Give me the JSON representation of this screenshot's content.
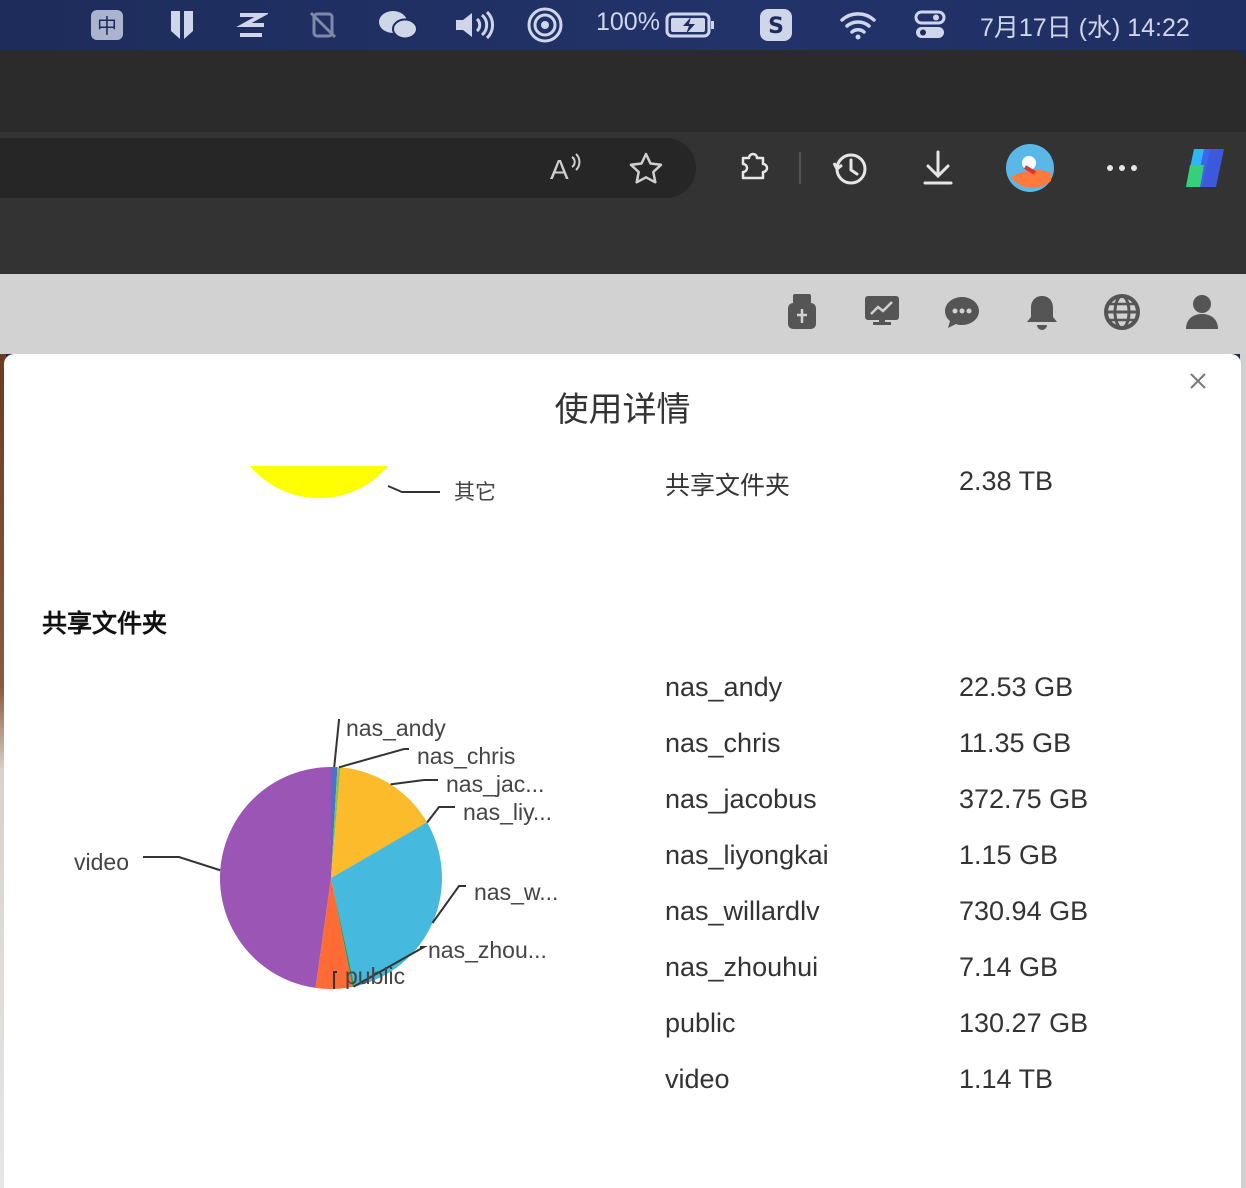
{
  "menubar": {
    "icons": [
      "input-method-zhong-icon",
      "bookmark-app-icon",
      "z-app-icon",
      "muted-app-icon",
      "wechat-icon",
      "volume-icon",
      "airdrop-icon",
      "battery-icon",
      "sogou-icon",
      "wifi-icon",
      "control-center-icon"
    ],
    "battery_text": "100%",
    "clock": "7月17日 (水)  14:22"
  },
  "browser": {
    "toolbar_icons": [
      "read-aloud-icon",
      "favorite-star-icon",
      "extensions-icon",
      "history-icon",
      "downloads-icon",
      "profile-avatar-icon",
      "more-menu-icon",
      "copilot-icon"
    ]
  },
  "nas_header": {
    "icons": [
      "usb-device-icon",
      "resource-monitor-icon",
      "messages-icon",
      "notifications-bell-icon",
      "network-globe-icon",
      "user-account-icon"
    ]
  },
  "modal": {
    "title": "使用详情",
    "top_row": {
      "label": "共享文件夹",
      "value": "2.38 TB"
    },
    "top_chart_label": "其它",
    "section_heading": "共享文件夹",
    "rows": [
      {
        "label": "nas_andy",
        "value": "22.53 GB"
      },
      {
        "label": "nas_chris",
        "value": "11.35 GB"
      },
      {
        "label": "nas_jacobus",
        "value": "372.75 GB"
      },
      {
        "label": "nas_liyongkai",
        "value": "1.15 GB"
      },
      {
        "label": "nas_willardlv",
        "value": "730.94 GB"
      },
      {
        "label": "nas_zhouhui",
        "value": "7.14 GB"
      },
      {
        "label": "public",
        "value": "130.27 GB"
      },
      {
        "label": "video",
        "value": "1.14 TB"
      }
    ]
  },
  "chart_data": {
    "type": "pie",
    "categories": [
      "nas_andy",
      "nas_chris",
      "nas_jac...",
      "nas_liy...",
      "nas_w...",
      "nas_zhou...",
      "public",
      "video"
    ],
    "values": [
      22.53,
      11.35,
      372.75,
      1.15,
      730.94,
      7.14,
      130.27,
      1167.36
    ],
    "unit": "GB",
    "colors": [
      "#4a72c9",
      "#8bc34a",
      "#fbbb2b",
      "#2e7d32",
      "#45bade",
      "#1f9d55",
      "#ff6b35",
      "#9b55b5"
    ]
  },
  "top_chart": {
    "color": "#ffff00"
  }
}
